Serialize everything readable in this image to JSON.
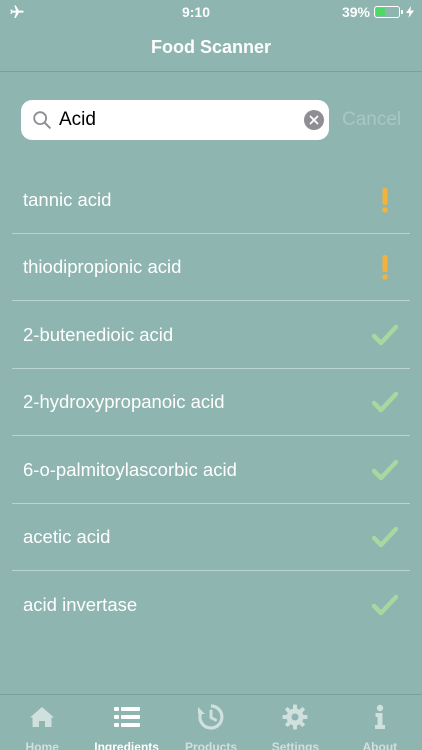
{
  "status_bar": {
    "time": "9:10",
    "battery": "39%",
    "battery_level": 0.39
  },
  "header": {
    "title": "Food Scanner"
  },
  "search": {
    "value": "Acid",
    "cancel_label": "Cancel"
  },
  "results": [
    {
      "label": "tannic acid",
      "status": "warning"
    },
    {
      "label": "thiodipropionic acid",
      "status": "warning"
    },
    {
      "label": "2-butenedioic acid",
      "status": "ok"
    },
    {
      "label": "2-hydroxypropanoic acid",
      "status": "ok"
    },
    {
      "label": "6-o-palmitoylascorbic acid",
      "status": "ok"
    },
    {
      "label": "acetic acid",
      "status": "ok"
    },
    {
      "label": "acid invertase",
      "status": "ok"
    }
  ],
  "colors": {
    "background": "#8fb5b0",
    "warning": "#f3b23a",
    "ok": "#a8d7a0"
  },
  "tabs": [
    {
      "label": "Home",
      "icon": "home-icon",
      "active": false
    },
    {
      "label": "Ingredients",
      "icon": "list-icon",
      "active": true
    },
    {
      "label": "Products",
      "icon": "history-icon",
      "active": false
    },
    {
      "label": "Settings",
      "icon": "gear-icon",
      "active": false
    },
    {
      "label": "About",
      "icon": "info-icon",
      "active": false
    }
  ]
}
